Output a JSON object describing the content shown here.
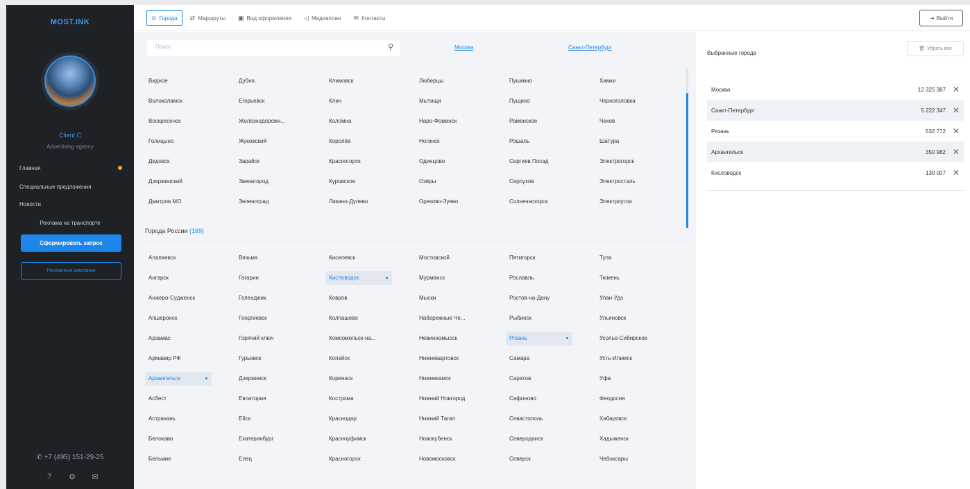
{
  "sidebar": {
    "logo": "MOST.INK",
    "client_name": "Client C",
    "client_type": "Advertising agency",
    "nav": [
      "Главная",
      "Специальные предложения",
      "Новости"
    ],
    "nav_ad": "Реклама на транспорте",
    "primary_button": "Сформировать запрос",
    "outline_button": "Рекламные кампании",
    "phone": "+7 (495) 151-29-25",
    "accent_color": "#1d86e8",
    "dot_color": "#f7a928"
  },
  "topbar": {
    "tabs": [
      {
        "label": "Города",
        "icon": "pin-icon"
      },
      {
        "label": "Маршруты",
        "icon": "route-icon"
      },
      {
        "label": "Вид оформления",
        "icon": "bus-icon"
      },
      {
        "label": "Медиаплан",
        "icon": "megaphone-icon"
      },
      {
        "label": "Контакты",
        "icon": "mail-icon"
      }
    ],
    "logout": "Выйти"
  },
  "search": {
    "placeholder": "Поиск"
  },
  "quick_links": [
    "Москва",
    "Санкт-Петербург"
  ],
  "region_cities": [
    "Видное",
    "Дубна",
    "Климовск",
    "Люберцы",
    "Пушкино",
    "Химки",
    "Волоколамск",
    "Егорьевск",
    "Клин",
    "Мытищи",
    "Пущино",
    "Черноголовка",
    "Воскресенск",
    "Железнодорожн...",
    "Коломна",
    "Наро-Фоминск",
    "Раменское",
    "Чехов",
    "Голицыно",
    "Жуковский",
    "Королёв",
    "Ногинск",
    "Рошаль",
    "Шатура",
    "Дедовск",
    "Зарайск",
    "Красногорск",
    "Одинцово",
    "Сергиев Посад",
    "Электрогорск",
    "Дзержинский",
    "Звенигород",
    "Куровское",
    "Озёры",
    "Серпухов",
    "Электросталь",
    "Дмитров МО",
    "Зеленоград",
    "Ликино-Дулево",
    "Орехово-Зуево",
    "Солнечногорск",
    "Электроугли"
  ],
  "russia_section": {
    "title": "Города России",
    "count": "(169)"
  },
  "russia_cities": [
    "Алапаевск",
    "Вязьма",
    "Киселевск",
    "Мостовской",
    "Пятигорск",
    "Тула",
    "Ангарск",
    "Гагарин",
    "Кисловодск",
    "Мурманск",
    "Рославль",
    "Тюмень",
    "Анжеро-Судженск",
    "Геленджик",
    "Ковров",
    "Мыски",
    "Ростов-на-Дону",
    "Улан-Удэ",
    "Апшеронск",
    "Георгиевск",
    "Колпашево",
    "Набережные Че...",
    "Рыбинск",
    "Ульяновск",
    "Арзамас",
    "Горячий ключ",
    "Комсомольск-на...",
    "Невинномысск",
    "Рязань",
    "Усолье-Сибирское",
    "Армавир РФ",
    "Гурьевск",
    "Копейск",
    "Нижневартовск",
    "Самара",
    "Усть-Илимск",
    "Архангельск",
    "Дзержинск",
    "Коренаск",
    "Нижнекамск",
    "Саратов",
    "Уфа",
    "Асбест",
    "Евпатория",
    "Кострома",
    "Нижний Новгород",
    "Сафоново",
    "Феодосия",
    "Астрахань",
    "Ейск",
    "Краснодар",
    "Нижний Тагил",
    "Севастополь",
    "Хабаровск",
    "Белокаво",
    "Екатеринбург",
    "Красноуфимск",
    "Новокубенск",
    "Североданск",
    "Хадыженск",
    "Бельмие",
    "Елец",
    "Красногорск",
    "Новомосковск",
    "Северск",
    "Чебоксары"
  ],
  "selected_in_grid": [
    "Кисловодск",
    "Рязань",
    "Архангельск"
  ],
  "right": {
    "title": "Выбранные города",
    "clear": "Убрать все",
    "selected": [
      {
        "name": "Москва",
        "population": "12 325 387"
      },
      {
        "name": "Санкт-Петербург",
        "population": "5 222 347"
      },
      {
        "name": "Рязань",
        "population": "532 772"
      },
      {
        "name": "Архангельск",
        "population": "350 982"
      },
      {
        "name": "Кисловодск",
        "population": "130 007"
      }
    ]
  }
}
